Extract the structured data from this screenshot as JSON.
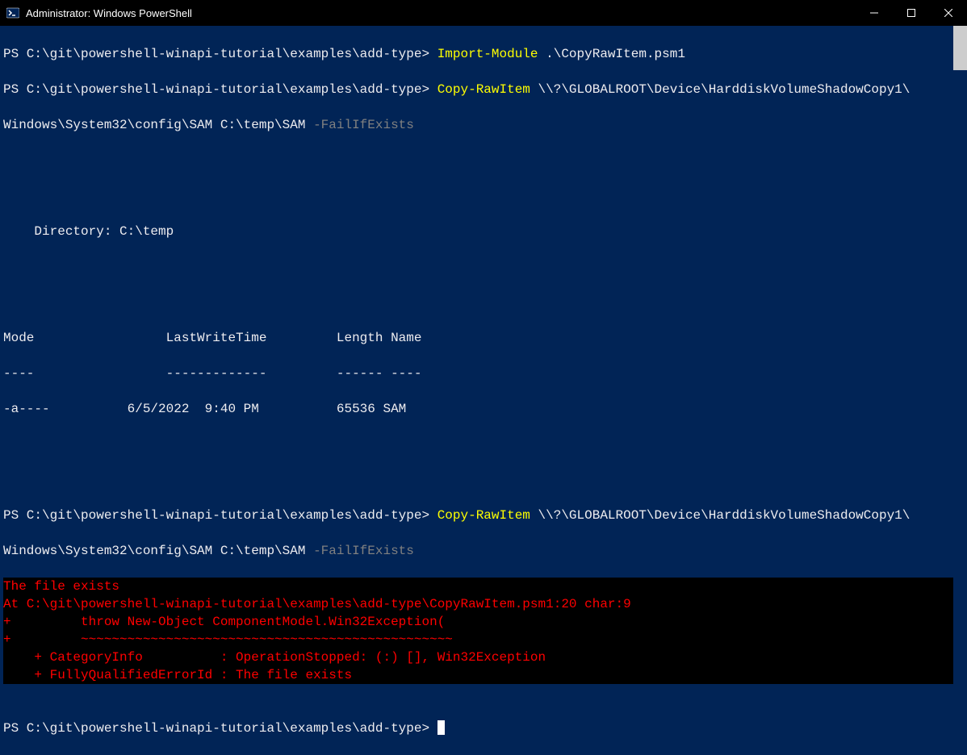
{
  "titlebar": {
    "title": "Administrator: Windows PowerShell"
  },
  "prompt1": {
    "ps": "PS C:\\git\\powershell-winapi-tutorial\\examples\\add-type> ",
    "cmdlet": "Import-Module",
    "arg": " .\\CopyRawItem.psm1"
  },
  "prompt2": {
    "ps": "PS C:\\git\\powershell-winapi-tutorial\\examples\\add-type> ",
    "cmdlet": "Copy-RawItem",
    "arg1": " \\\\?\\GLOBALROOT\\Device\\HarddiskVolumeShadowCopy1\\",
    "arg2": "Windows\\System32\\config\\SAM C:\\temp\\SAM ",
    "param": "-FailIfExists"
  },
  "directory": {
    "line": "    Directory: C:\\temp",
    "header1": "Mode                 LastWriteTime         Length Name",
    "header2": "----                 -------------         ------ ----",
    "row1": "-a----          6/5/2022  9:40 PM          65536 SAM"
  },
  "prompt3": {
    "ps": "PS C:\\git\\powershell-winapi-tutorial\\examples\\add-type> ",
    "cmdlet": "Copy-RawItem",
    "arg1": " \\\\?\\GLOBALROOT\\Device\\HarddiskVolumeShadowCopy1\\",
    "arg2": "Windows\\System32\\config\\SAM C:\\temp\\SAM ",
    "param": "-FailIfExists"
  },
  "error": {
    "line1": "The file exists",
    "line2": "At C:\\git\\powershell-winapi-tutorial\\examples\\add-type\\CopyRawItem.psm1:20 char:9",
    "line3": "+         throw New-Object ComponentModel.Win32Exception(",
    "line4": "+         ~~~~~~~~~~~~~~~~~~~~~~~~~~~~~~~~~~~~~~~~~~~~~~~~",
    "line5": "    + CategoryInfo          : OperationStopped: (:) [], Win32Exception",
    "line6": "    + FullyQualifiedErrorId : The file exists"
  },
  "prompt4": {
    "ps": "PS C:\\git\\powershell-winapi-tutorial\\examples\\add-type> "
  }
}
